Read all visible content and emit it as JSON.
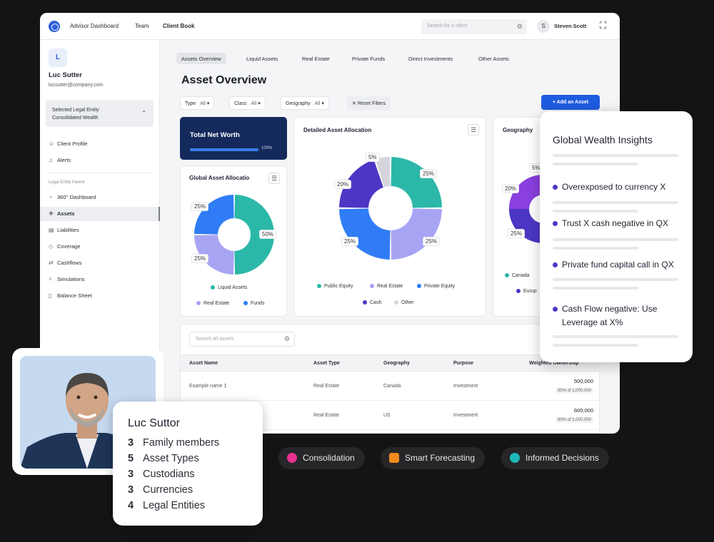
{
  "topbar": {
    "nav": [
      "Advisor Dashboard",
      "Team",
      "Client Book"
    ],
    "active_nav": "Client Book",
    "search_placeholder": "Search for a client",
    "user_initial": "S",
    "user_name": "Steven Scott"
  },
  "sidebar": {
    "client_initial": "L",
    "client_name": "Luc Sutter",
    "client_email": "lucsutter@company.com",
    "entity_label": "Selected Legal Entity",
    "entity_value": "Consolidated Wealth",
    "items_top": [
      {
        "label": "Client Profile",
        "icon": "user-icon"
      },
      {
        "label": "Alerts",
        "icon": "bell-icon"
      }
    ],
    "section_label": "Legal Entity Parent",
    "items": [
      {
        "label": "360° Dashboard",
        "icon": "dashboard-icon"
      },
      {
        "label": "Assets",
        "icon": "assets-icon",
        "active": true
      },
      {
        "label": "Liabilities",
        "icon": "liabilities-icon"
      },
      {
        "label": "Coverage",
        "icon": "shield-icon"
      },
      {
        "label": "Cashflows",
        "icon": "cashflow-icon"
      },
      {
        "label": "Simulations",
        "icon": "branch-icon"
      },
      {
        "label": "Balance Sheet",
        "icon": "document-icon"
      }
    ]
  },
  "tabs": [
    "Assets Overview",
    "Liquid Assets",
    "Real Estate",
    "Private Funds",
    "Direct Investments",
    "Other Assets"
  ],
  "page_title": "Asset Overview",
  "filters": [
    {
      "label": "Type",
      "value": "All"
    },
    {
      "label": "Class",
      "value": "All"
    },
    {
      "label": "Geography",
      "value": "All"
    }
  ],
  "reset_label": "Reset Filters",
  "add_button": "+ Add an Asset",
  "net_worth": {
    "title": "Total Net Worth",
    "progress": 100,
    "progress_label": "100%"
  },
  "colors": {
    "teal": "#2bb8a8",
    "lavender": "#a8a4f4",
    "blue": "#2f7cf6",
    "indigo": "#4b37c4",
    "gray": "#d3d5da",
    "purple": "#8a3fe0"
  },
  "chart_data": [
    {
      "type": "pie",
      "title": "Global Asset Allocatio",
      "labels": [
        "Liquid Assets",
        "Real Estate",
        "Funds"
      ],
      "values": [
        50,
        25,
        25
      ],
      "value_labels": [
        "50%",
        "25%",
        "25%"
      ],
      "colors": [
        "#2bb8a8",
        "#a8a4f4",
        "#2f7cf6"
      ]
    },
    {
      "type": "pie",
      "title": "Detailed Asset Allocation",
      "labels": [
        "Public Equity",
        "Real Estate",
        "Private Equity",
        "Cash",
        "Other"
      ],
      "values": [
        25,
        25,
        25,
        20,
        5
      ],
      "value_labels": [
        "25%",
        "25%",
        "25%",
        "20%",
        "5%"
      ],
      "colors": [
        "#2bb8a8",
        "#a8a4f4",
        "#2f7cf6",
        "#4b37c4",
        "#d3d5da"
      ]
    },
    {
      "type": "pie",
      "title": "Geography",
      "labels": [
        "Canada",
        "Europ"
      ],
      "visible_value_labels": [
        "5%",
        "20%",
        "25%"
      ]
    }
  ],
  "table": {
    "search_placeholder": "Search all assets",
    "columns": [
      "Asset Name",
      "Asset Type",
      "Geography",
      "Purpose",
      "Weighted Ownership"
    ],
    "rows": [
      {
        "name": "Example name 1",
        "type": "Real Estate",
        "geo": "Canada",
        "purpose": "Investment",
        "amount": "500,000",
        "sub": "50% of 1,000,000"
      },
      {
        "name": "",
        "type": "Real Estate",
        "geo": "US",
        "purpose": "Investment",
        "amount": "600,000",
        "sub": "50% of 1,000,000"
      }
    ]
  },
  "insights": {
    "title": "Global Wealth Insights",
    "items": [
      "Overexposed to currency X",
      "Trust X cash negative in QX",
      "Private fund capital call in QX",
      "Cash Flow negative: Use Leverage at X%"
    ]
  },
  "profile": {
    "name": "Luc Suttor",
    "rows": [
      {
        "num": "3",
        "label": "Family members"
      },
      {
        "num": "5",
        "label": "Asset Types"
      },
      {
        "num": "3",
        "label": "Custodians"
      },
      {
        "num": "3",
        "label": "Currencies"
      },
      {
        "num": "4",
        "label": "Legal Entities"
      }
    ]
  },
  "features": [
    {
      "label": "Consolidation",
      "icon": "pie-icon",
      "color": "#e6338f"
    },
    {
      "label": "Smart Forecasting",
      "icon": "chart-icon",
      "color": "#f08a1c"
    },
    {
      "label": "Informed Decisions",
      "icon": "bulb-icon",
      "color": "#1fb8b8"
    }
  ]
}
